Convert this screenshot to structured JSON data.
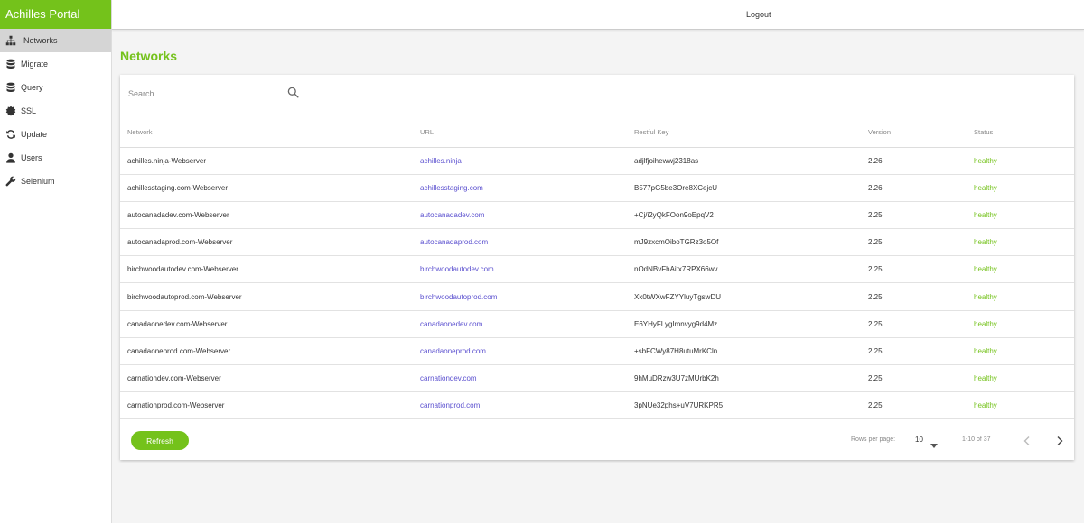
{
  "app": {
    "title": "Achilles Portal"
  },
  "header": {
    "logout_label": "Logout"
  },
  "sidebar": {
    "items": [
      {
        "label": "Networks",
        "icon": "sitemap-icon"
      },
      {
        "label": "Migrate",
        "icon": "database-icon"
      },
      {
        "label": "Query",
        "icon": "database-icon"
      },
      {
        "label": "SSL",
        "icon": "certificate-icon"
      },
      {
        "label": "Update",
        "icon": "sync-icon"
      },
      {
        "label": "Users",
        "icon": "user-icon"
      },
      {
        "label": "Selenium",
        "icon": "wrench-icon"
      }
    ],
    "active": "Networks"
  },
  "main": {
    "page_title": "Networks",
    "search_placeholder": "Search",
    "table": {
      "headers": [
        "Network",
        "URL",
        "Restful Key",
        "Version",
        "Status"
      ],
      "rows": [
        [
          "achilles.ninja-Webserver",
          "achilles.ninja",
          "adjlfjoihewwj2318as",
          "2.26",
          "healthy"
        ],
        [
          "achillesstaging.com-Webserver",
          "achillesstaging.com",
          "B577pG5be3Ore8XCejcU",
          "2.26",
          "healthy"
        ],
        [
          "autocanadadev.com-Webserver",
          "autocanadadev.com",
          "+Cj/i2yQkFOon9oEpqV2",
          "2.25",
          "healthy"
        ],
        [
          "autocanadaprod.com-Webserver",
          "autocanadaprod.com",
          "mJ9zxcmOiboTGRz3o5Of",
          "2.25",
          "healthy"
        ],
        [
          "birchwoodautodev.com-Webserver",
          "birchwoodautodev.com",
          "nOdNBvFhAitx7RPX66wv",
          "2.25",
          "healthy"
        ],
        [
          "birchwoodautoprod.com-Webserver",
          "birchwoodautoprod.com",
          "Xk0tWXwFZYYluyTgswDU",
          "2.25",
          "healthy"
        ],
        [
          "canadaonedev.com-Webserver",
          "canadaonedev.com",
          "E6YHyFLygImnvyg9d4Mz",
          "2.25",
          "healthy"
        ],
        [
          "canadaoneprod.com-Webserver",
          "canadaoneprod.com",
          "+sbFCWy87H8utuMrKCln",
          "2.25",
          "healthy"
        ],
        [
          "carnationdev.com-Webserver",
          "carnationdev.com",
          "9hMuDRzw3U7zMUrbK2h",
          "2.25",
          "healthy"
        ],
        [
          "carnationprod.com-Webserver",
          "carnationprod.com",
          "3pNUe32phs+uV7URKPR5",
          "2.25",
          "healthy"
        ]
      ]
    },
    "refresh_label": "Refresh",
    "pagination": {
      "rows_per_page_label": "Rows per page:",
      "rows_per_page": "10",
      "range": "1-10 of 37"
    }
  },
  "colors": {
    "accent": "#74c21b",
    "link": "#5a4fcf",
    "active_nav": "#d5d5d5"
  }
}
